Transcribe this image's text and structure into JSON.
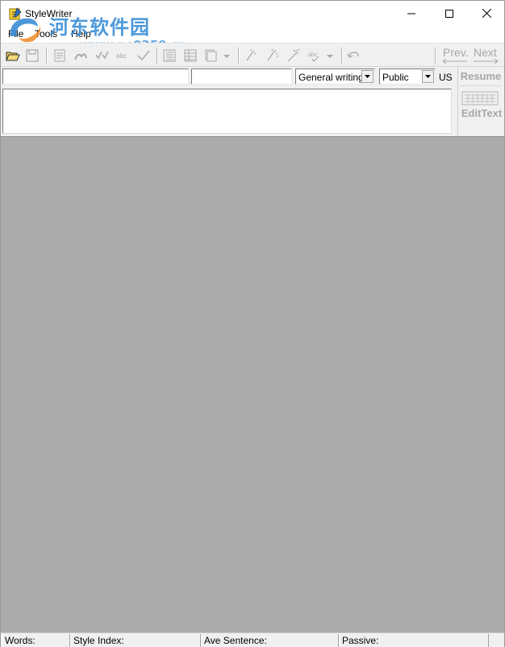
{
  "window": {
    "title": "StyleWriter"
  },
  "watermark": {
    "site_name": "河东软件园",
    "url": "www.pc0359.cn"
  },
  "menu": {
    "items": [
      "File",
      "Tools",
      "Help"
    ]
  },
  "toolbar": {
    "prev_label": "Prev.",
    "next_label": "Next",
    "disabled_color": "#a7a7a7"
  },
  "fields": {
    "field1_value": "",
    "field2_value": "",
    "writing_type": "General writing",
    "audience": "Public",
    "region": "US"
  },
  "side_pane": {
    "resume_label": "Resume",
    "edit_text_label": "EditText"
  },
  "text_panel": {
    "value": ""
  },
  "workspace": {
    "background": "#ababab"
  },
  "status_bar": {
    "words_label": "Words:",
    "style_index_label": "Style Index:",
    "ave_sentence_label": "Ave Sentence:",
    "passive_label": "Passive:"
  }
}
